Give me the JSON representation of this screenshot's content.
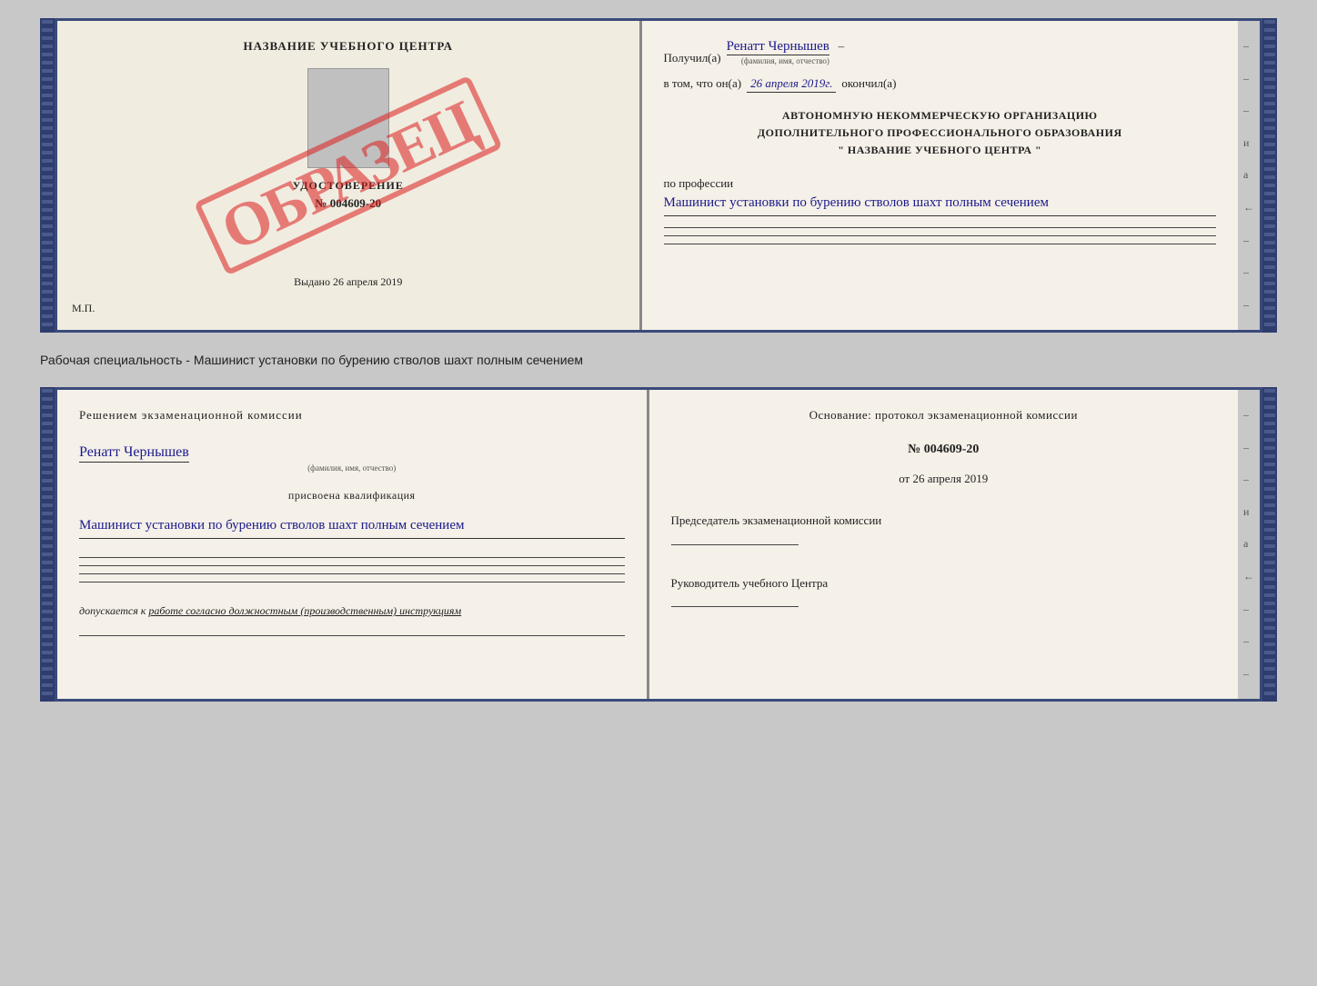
{
  "doc1": {
    "left": {
      "cert_title": "НАЗВАНИЕ УЧЕБНОГО ЦЕНТРА",
      "udost_label": "УДОСТОВЕРЕНИЕ",
      "cert_number": "№ 004609-20",
      "vydano_text": "Выдано",
      "vydano_date": "26 апреля 2019",
      "mp_label": "М.П.",
      "obrazec": "ОБРАЗЕЦ"
    },
    "right": {
      "poluchil_label": "Получил(а)",
      "fio_value": "Ренатт Чернышев",
      "fio_hint": "(фамилия, имя, отчество)",
      "vtom_label": "в том, что он(а)",
      "vtom_date": "26 апреля 2019г.",
      "okonchil_label": "окончил(а)",
      "org_line1": "АВТОНОМНУЮ НЕКОММЕРЧЕСКУЮ ОРГАНИЗАЦИЮ",
      "org_line2": "ДОПОЛНИТЕЛЬНОГО ПРОФЕССИОНАЛЬНОГО ОБРАЗОВАНИЯ",
      "org_line3": "\" НАЗВАНИЕ УЧЕБНОГО ЦЕНТРА \"",
      "po_professii_label": "по профессии",
      "profession_value": "Машинист установки по бурению стволов шахт полным сечением"
    }
  },
  "specialty": {
    "label": "Рабочая специальность - Машинист установки по бурению стволов шахт полным сечением"
  },
  "doc2": {
    "left": {
      "decision_title": "Решением экзаменационной комиссии",
      "fio_value": "Ренатт Чернышев",
      "fio_hint": "(фамилия, имя, отчество)",
      "prisvoena_label": "присвоена квалификация",
      "kvali_value": "Машинист установки по бурению стволов шахт полным сечением",
      "dopuskaetsya_label": "допускается к",
      "dopuskaetsya_value": "работе согласно должностным (производственным) инструкциям"
    },
    "right": {
      "osnov_label": "Основание: протокол экзаменационной комиссии",
      "protocol_number": "№ 004609-20",
      "protocol_date_prefix": "от",
      "protocol_date": "26 апреля 2019",
      "chair_label": "Председатель экзаменационной комиссии",
      "rukv_label": "Руководитель учебного Центра"
    }
  },
  "margin_chars": {
    "right_side": [
      "–",
      "–",
      "–",
      "и",
      "а",
      "←",
      "–",
      "–",
      "–"
    ]
  }
}
